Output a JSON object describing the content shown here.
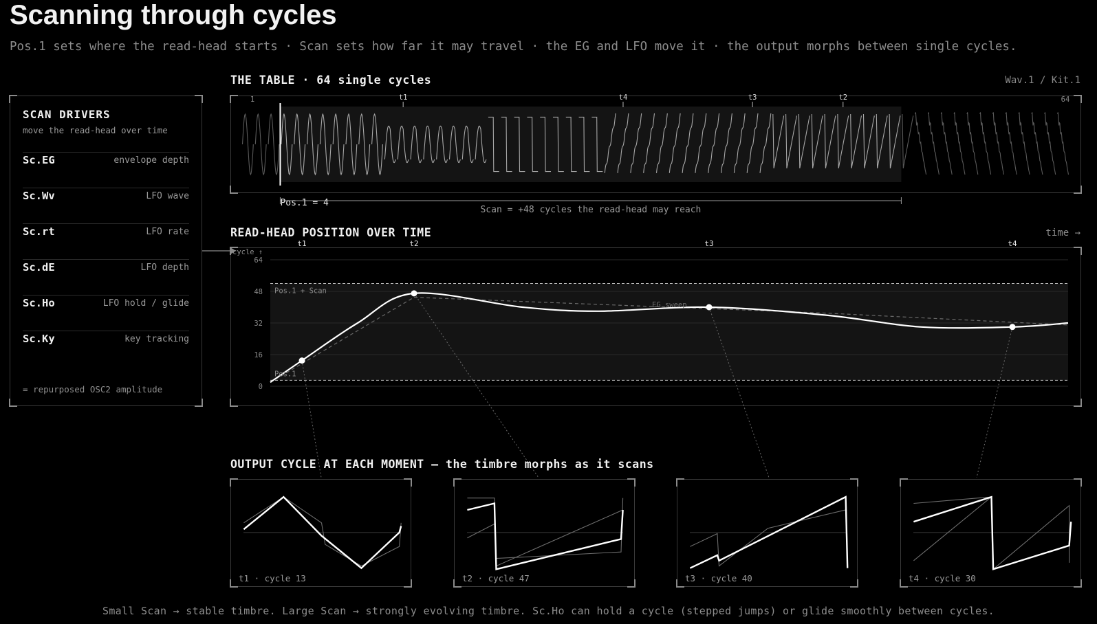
{
  "title": "Scanning through cycles",
  "subtitle": "Pos.1 sets where the read-head starts · Scan sets how far it may travel · the EG and LFO move it · the output morphs between single cycles.",
  "drivers": {
    "title": "SCAN DRIVERS",
    "subtitle": "move the read-head over time",
    "items": [
      {
        "name": "Sc.EG",
        "desc": "envelope depth"
      },
      {
        "name": "Sc.Wv",
        "desc": "LFO wave"
      },
      {
        "name": "Sc.rt",
        "desc": "LFO rate"
      },
      {
        "name": "Sc.dE",
        "desc": "LFO depth"
      },
      {
        "name": "Sc.Ho",
        "desc": "LFO hold / glide"
      },
      {
        "name": "Sc.Ky",
        "desc": "key tracking"
      }
    ],
    "note": "= repurposed OSC2 amplitude"
  },
  "table": {
    "title": "THE TABLE · 64 single cycles",
    "source": "Wav.1 / Kit.1",
    "cycles": 64,
    "first_label": "1",
    "last_label": "64",
    "pos1": 4,
    "scan": 48,
    "pos_label": "Pos.1 = 4",
    "scan_label": "Scan = +48 cycles the read-head may reach",
    "markers": [
      {
        "label": "t1",
        "cycle": 13
      },
      {
        "label": "t4",
        "cycle": 30
      },
      {
        "label": "t3",
        "cycle": 40
      },
      {
        "label": "t2",
        "cycle": 47
      }
    ]
  },
  "position_chart": {
    "title": "READ-HEAD POSITION OVER TIME",
    "time_label": "time →",
    "y_axis_label": "cycle ↑",
    "y_ticks": [
      "64",
      "48",
      "32",
      "16",
      "0"
    ],
    "band_top_label": "Pos.1 + Scan",
    "band_bottom_label": "Pos.1",
    "sweep_label": "EG sweep",
    "markers": [
      {
        "label": "t1",
        "cycle": 13
      },
      {
        "label": "t2",
        "cycle": 47
      },
      {
        "label": "t3",
        "cycle": 40
      },
      {
        "label": "t4",
        "cycle": 30
      }
    ]
  },
  "output": {
    "title": "OUTPUT CYCLE AT EACH MOMENT — the timbre morphs as it scans",
    "panels": [
      {
        "label": "t1 · cycle 13",
        "shape": "triangle"
      },
      {
        "label": "t2 · cycle 47",
        "shape": "bigsaw"
      },
      {
        "label": "t3 · cycle 40",
        "shape": "ramp"
      },
      {
        "label": "t4 · cycle 30",
        "shape": "sawdown"
      }
    ]
  },
  "footer": "Small Scan → stable timbre. Large Scan → strongly evolving timbre. Sc.Ho can hold a cycle (stepped jumps) or glide smoothly between cycles."
}
